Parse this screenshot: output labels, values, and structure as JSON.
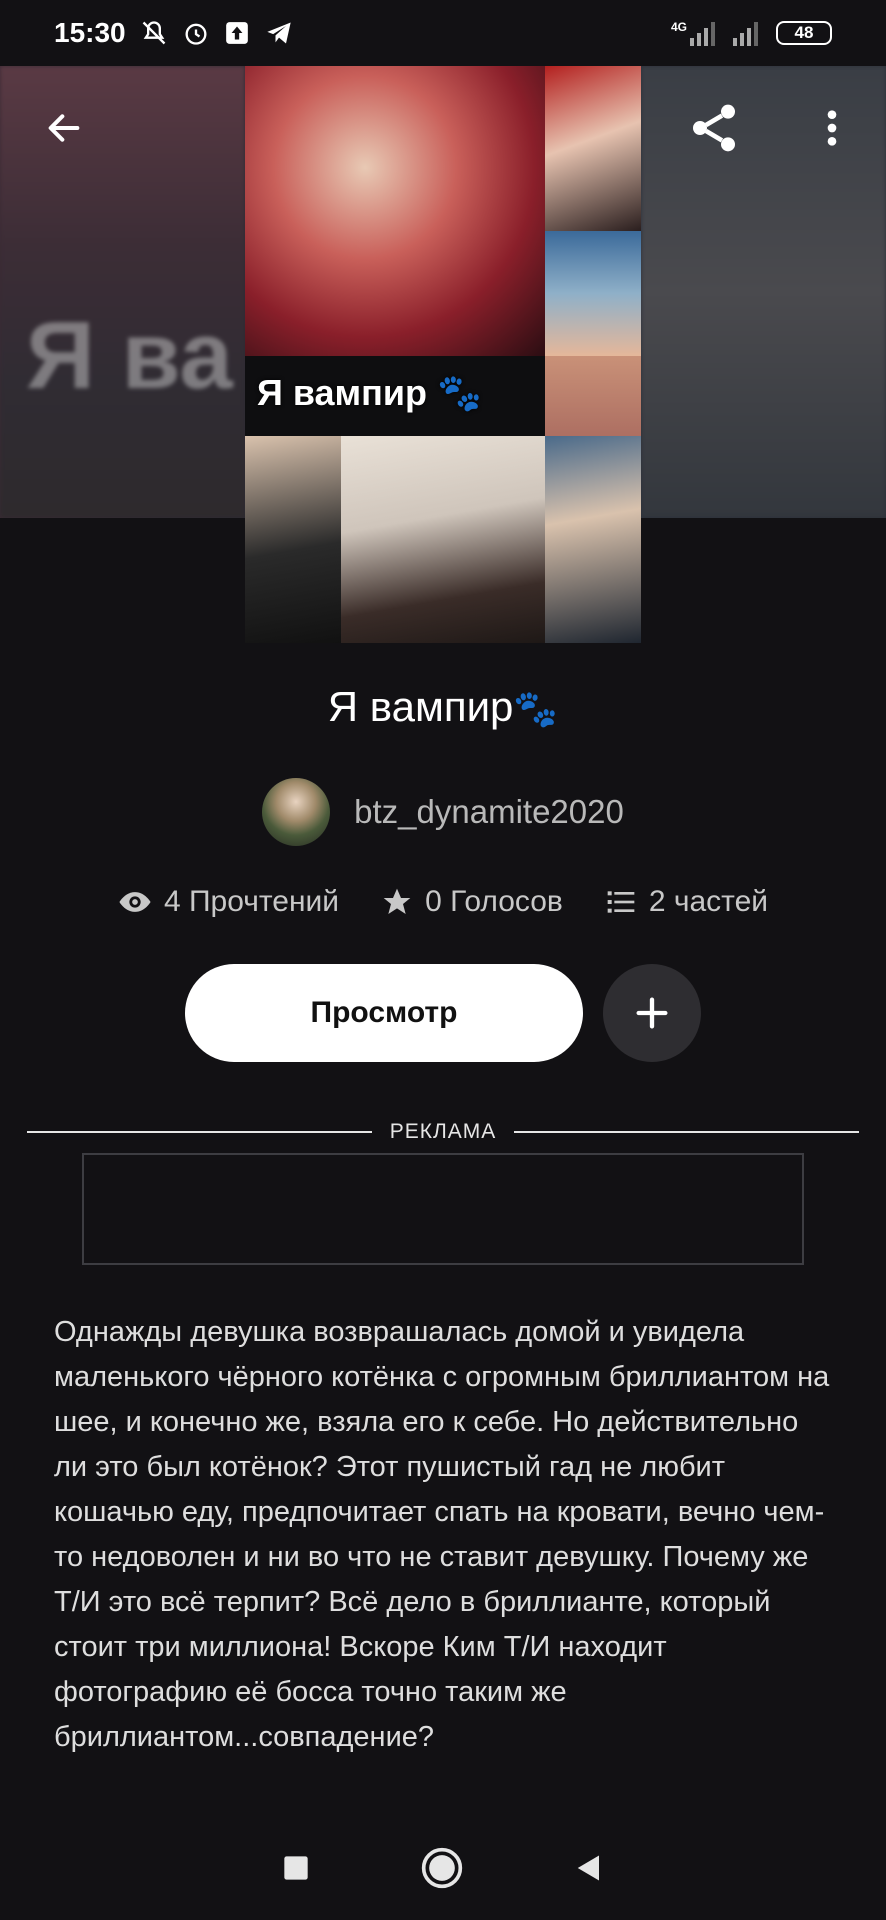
{
  "status_bar": {
    "time": "15:30",
    "network_1": "4G",
    "battery": "48"
  },
  "header": {
    "back_icon": "arrow-left-icon",
    "share_icon": "share-icon",
    "more_icon": "more-vertical-icon"
  },
  "cover": {
    "caption": "Я вампир"
  },
  "story": {
    "title": "Я вампир",
    "author": "btz_dynamite2020",
    "stats": {
      "reads": "4 Прочтений",
      "votes": "0 Голосов",
      "parts": "2 частей"
    },
    "view_button": "Просмотр",
    "description": "Однажды девушка возврашалась домой и увидела маленького чёрного котёнка с огромным бриллиантом на шее, и конечно же, взяла его к себе. Но действительно ли это был котёнок? Этот пушистый гад не любит кошачью еду, предпочитает спать на кровати, вечно чем-то недоволен и ни во что не ставит девушку. Почему же Т/И это всё терпит? Всё дело в бриллианте, который стоит три миллиона! Вскоре Ким Т/И находит фотографию её босса точно таким же бриллиантом...совпадение?"
  },
  "ad": {
    "label": "РЕКЛАМА"
  },
  "colors": {
    "background": "#121114",
    "paw": "#e0401a",
    "button_bg": "#ffffff",
    "add_button_bg": "#2e2d31"
  }
}
